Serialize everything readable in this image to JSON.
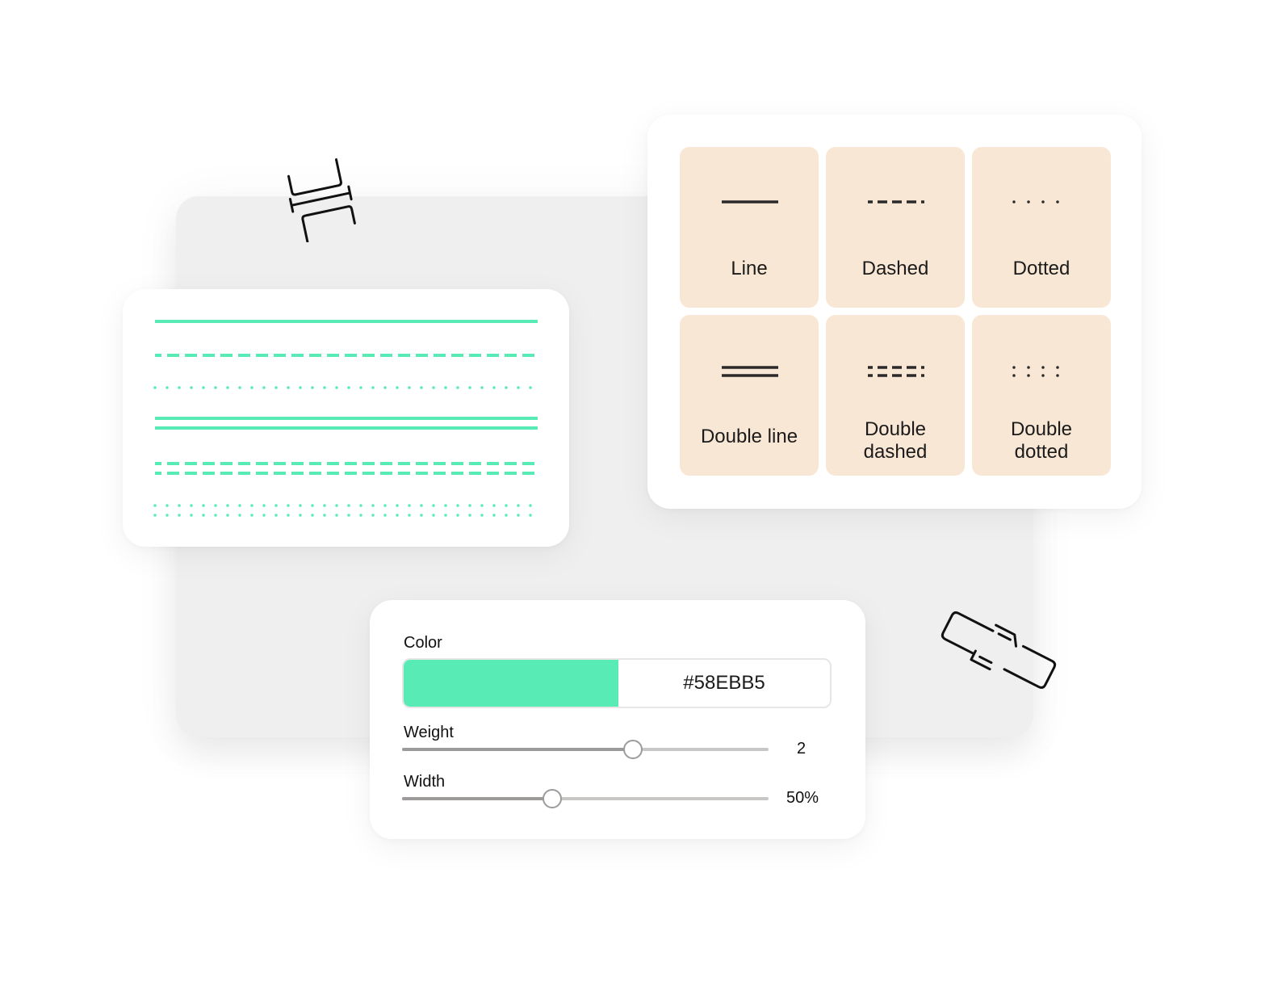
{
  "preview": {
    "line_color": "#58EBB5",
    "rows": [
      {
        "style": "line"
      },
      {
        "style": "dashed"
      },
      {
        "style": "dotted"
      },
      {
        "style": "double-line"
      },
      {
        "style": "double-dashed"
      },
      {
        "style": "double-dotted"
      }
    ]
  },
  "styles": {
    "tile_color": "#F9E7D5",
    "glyph_color": "#2A2A2A",
    "items": [
      {
        "id": "line",
        "label": "Line"
      },
      {
        "id": "dashed",
        "label": "Dashed"
      },
      {
        "id": "dotted",
        "label": "Dotted"
      },
      {
        "id": "double-line",
        "label": "Double line"
      },
      {
        "id": "double-dashed",
        "label_line1": "Double",
        "label_line2": "dashed"
      },
      {
        "id": "double-dotted",
        "label_line1": "Double",
        "label_line2": "dotted"
      }
    ]
  },
  "settings": {
    "color": {
      "label": "Color",
      "value": "#58EBB5",
      "swatch": "#58EBB5"
    },
    "weight": {
      "label": "Weight",
      "value": "2",
      "fraction": 0.63
    },
    "width": {
      "label": "Width",
      "value": "50%",
      "fraction": 0.41
    }
  },
  "icons": {
    "top_left": "split-horizontal-icon",
    "bottom_right": "break-link-icon"
  }
}
